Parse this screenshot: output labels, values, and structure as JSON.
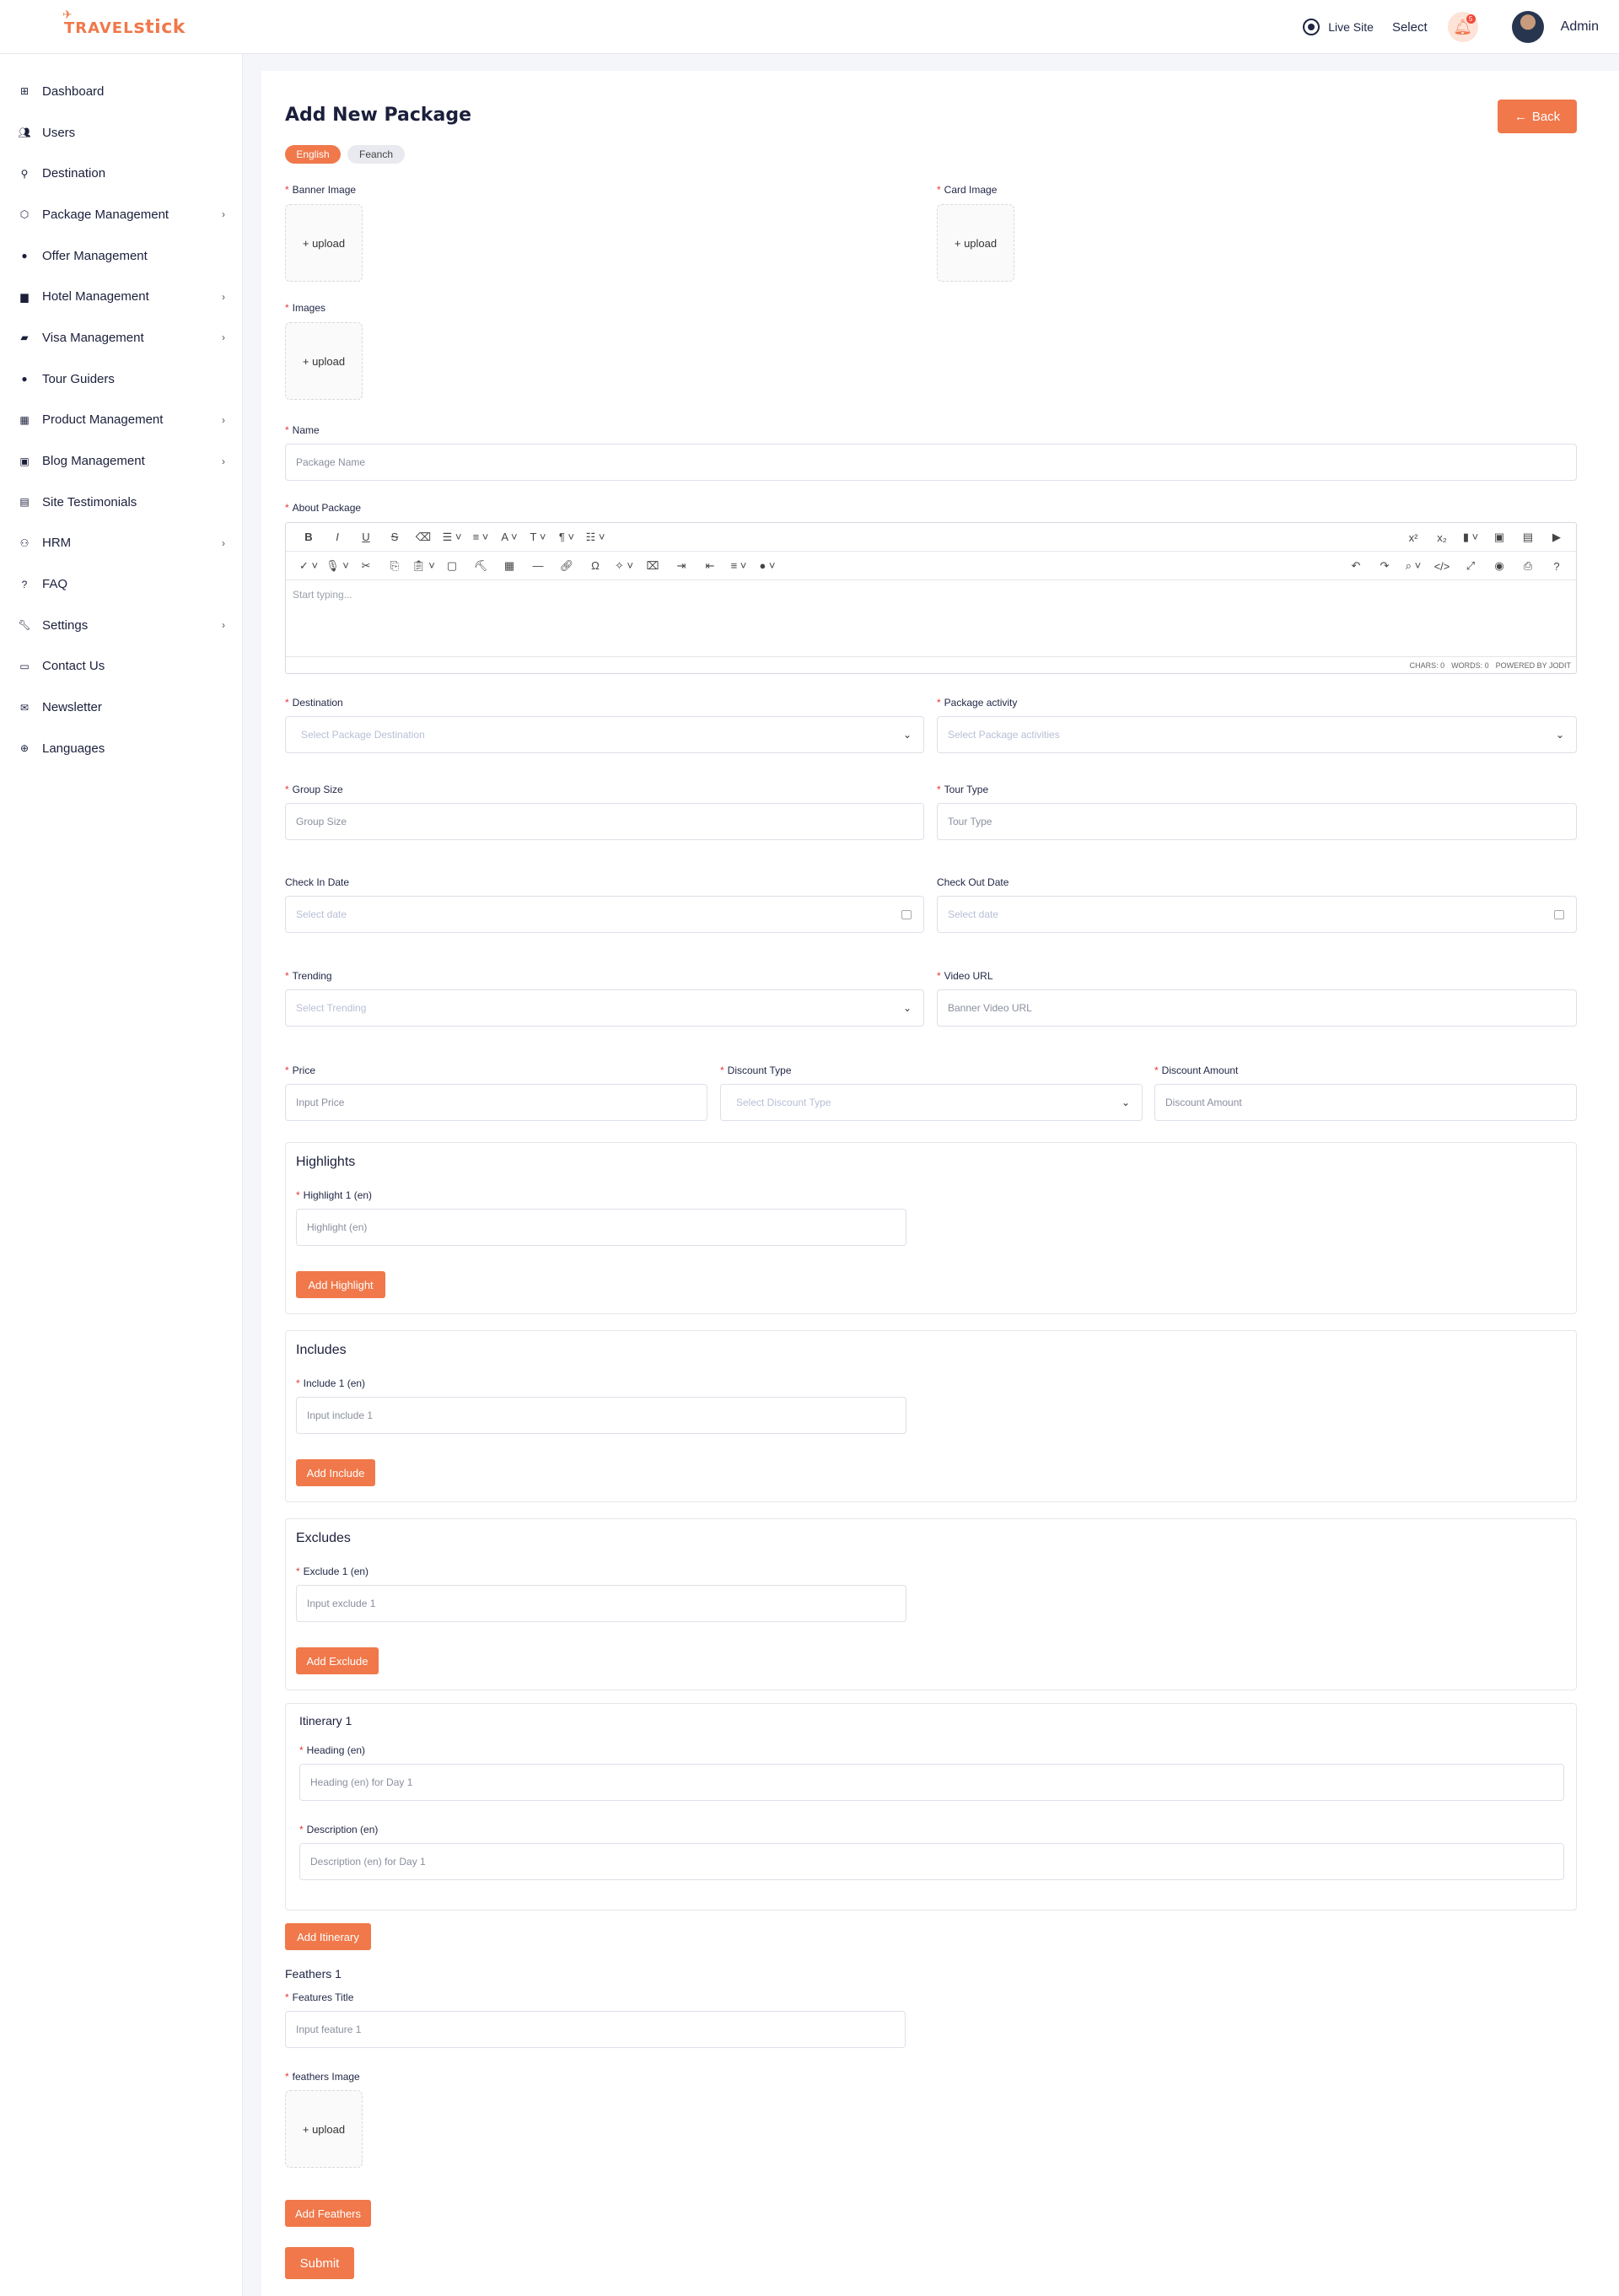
{
  "header": {
    "logo_text_a": "TRAVEL",
    "logo_text_b": "stick",
    "live_site": "Live Site",
    "select": "Select",
    "notif_count": "5",
    "user": "Admin"
  },
  "sidebar": {
    "items": [
      {
        "label": "Dashboard",
        "icon": "dashboard-icon",
        "chev": false
      },
      {
        "label": "Users",
        "icon": "users-icon",
        "chev": false
      },
      {
        "label": "Destination",
        "icon": "destination-icon",
        "chev": false
      },
      {
        "label": "Package Management",
        "icon": "package-icon",
        "chev": true
      },
      {
        "label": "Offer Management",
        "icon": "offer-icon",
        "chev": false
      },
      {
        "label": "Hotel Management",
        "icon": "hotel-icon",
        "chev": true
      },
      {
        "label": "Visa Management",
        "icon": "visa-icon",
        "chev": true
      },
      {
        "label": "Tour Guiders",
        "icon": "tour-guide-icon",
        "chev": false
      },
      {
        "label": "Product Management",
        "icon": "product-icon",
        "chev": true
      },
      {
        "label": "Blog Management",
        "icon": "blog-icon",
        "chev": true
      },
      {
        "label": "Site Testimonials",
        "icon": "testimonial-icon",
        "chev": false
      },
      {
        "label": "HRM",
        "icon": "hrm-icon",
        "chev": true
      },
      {
        "label": "FAQ",
        "icon": "faq-icon",
        "chev": false
      },
      {
        "label": "Settings",
        "icon": "settings-icon",
        "chev": true
      },
      {
        "label": "Contact Us",
        "icon": "contact-icon",
        "chev": false
      },
      {
        "label": "Newsletter",
        "icon": "newsletter-icon",
        "chev": false
      },
      {
        "label": "Languages",
        "icon": "languages-icon",
        "chev": false
      }
    ]
  },
  "page": {
    "title": "Add New Package",
    "back": "Back",
    "lang_en": "English",
    "lang_fr": "Feanch"
  },
  "form": {
    "banner_image": "Banner Image",
    "card_image": "Card Image",
    "images": "Images",
    "upload": "+ upload",
    "name": "Name",
    "name_ph": "Package Name",
    "about": "About Package",
    "editor_ph": "Start typing...",
    "editor_chars": "CHARS: 0",
    "editor_words": "WORDS: 0",
    "editor_powered": "POWERED BY JODIT",
    "destination": "Destination",
    "destination_ph": "Select Package Destination",
    "activity": "Package activity",
    "activity_ph": "Select Package activities",
    "group_size": "Group Size",
    "group_size_ph": "Group Size",
    "tour_type": "Tour Type",
    "tour_type_ph": "Tour Type",
    "check_in": "Check In Date",
    "check_out": "Check Out Date",
    "date_ph": "Select date",
    "trending": "Trending",
    "trending_ph": "Select Trending",
    "video_url": "Video URL",
    "video_url_ph": "Banner Video URL",
    "price": "Price",
    "price_ph": "Input Price",
    "discount_type": "Discount Type",
    "discount_type_ph": "Select Discount Type",
    "discount_amount": "Discount Amount",
    "discount_amount_ph": "Discount Amount"
  },
  "highlights": {
    "title": "Highlights",
    "label": "Highlight 1 (en)",
    "placeholder": "Highlight (en)",
    "button": "Add Highlight"
  },
  "includes": {
    "title": "Includes",
    "label": "Include 1 (en)",
    "placeholder": "Input include 1",
    "button": "Add Include"
  },
  "excludes": {
    "title": "Excludes",
    "label": "Exclude 1 (en)",
    "placeholder": "Input exclude 1",
    "button": "Add Exclude"
  },
  "itinerary": {
    "title": "Itinerary 1",
    "heading_label": "Heading (en)",
    "heading_ph": "Heading (en) for Day 1",
    "desc_label": "Description (en)",
    "desc_ph": "Description (en) for Day 1",
    "button": "Add Itinerary"
  },
  "feathers": {
    "title": "Feathers 1",
    "features_title": "Features Title",
    "features_ph": "Input feature 1",
    "image_label": "feathers Image",
    "button": "Add Feathers"
  },
  "submit": "Submit",
  "colors": {
    "accent": "#f0784a",
    "text": "#1f2544"
  }
}
